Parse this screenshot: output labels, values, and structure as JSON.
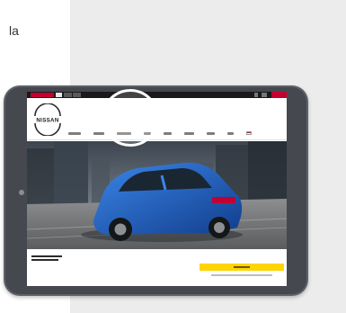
{
  "caption": {
    "text": "la"
  },
  "colors": {
    "nissan_red": "#c3002f",
    "cta_yellow": "#ffd400",
    "car_blue": "#1f5fc4",
    "tablet_frame": "#5e6168"
  },
  "tablet": {
    "screen": {
      "site": {
        "brand": "NISSAN",
        "nav_items": [
          {
            "icon": "menu-placeholder"
          },
          {
            "icon": "menu-placeholder"
          },
          {
            "icon": "menu-placeholder"
          },
          {
            "icon": "menu-placeholder"
          },
          {
            "icon": "menu-placeholder"
          },
          {
            "icon": "menu-placeholder"
          },
          {
            "icon": "menu-placeholder"
          },
          {
            "icon": "menu-placeholder"
          }
        ],
        "region_flag": "us-flag-icon",
        "hero": {
          "subject": "blue-suv-image"
        },
        "video": {
          "icon": "play-icon"
        }
      }
    }
  }
}
